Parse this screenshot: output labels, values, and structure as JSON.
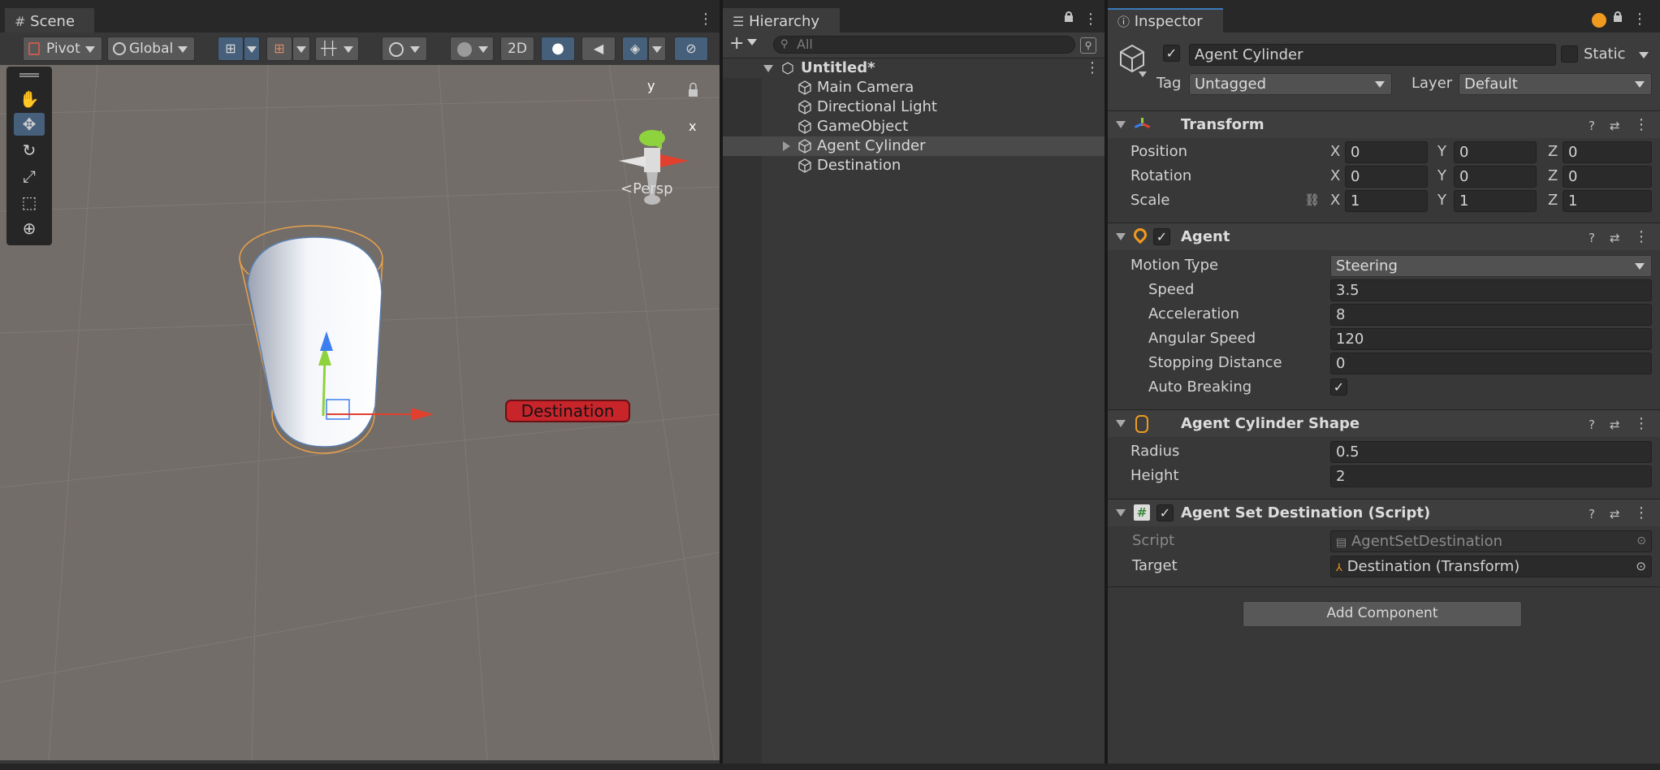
{
  "scene": {
    "tab_label": "Scene",
    "pivot_label": "Pivot",
    "global_label": "Global",
    "btn_2d": "2D",
    "persp_label": "Persp",
    "gizmo_y": "y",
    "gizmo_x": "x",
    "destination_label": "Destination",
    "tools": [
      "hand-tool-icon",
      "move-tool-icon",
      "rotate-tool-icon",
      "scale-tool-icon",
      "rect-tool-icon",
      "transform-tool-icon"
    ]
  },
  "hierarchy": {
    "tab_label": "Hierarchy",
    "search_placeholder": "All",
    "root": "Untitled*",
    "items": [
      "Main Camera",
      "Directional Light",
      "GameObject",
      "Agent Cylinder",
      "Destination"
    ]
  },
  "inspector": {
    "tab_label": "Inspector",
    "object_name": "Agent Cylinder",
    "static_label": "Static",
    "tag_label": "Tag",
    "tag_value": "Untagged",
    "layer_label": "Layer",
    "layer_value": "Default",
    "transform": {
      "title": "Transform",
      "position_label": "Position",
      "rotation_label": "Rotation",
      "scale_label": "Scale",
      "axis_x": "X",
      "axis_y": "Y",
      "axis_z": "Z",
      "position": [
        "0",
        "0",
        "0"
      ],
      "rotation": [
        "0",
        "0",
        "0"
      ],
      "scale": [
        "1",
        "1",
        "1"
      ]
    },
    "agent": {
      "title": "Agent",
      "motion_type_label": "Motion Type",
      "motion_type_value": "Steering",
      "speed_label": "Speed",
      "speed": "3.5",
      "acceleration_label": "Acceleration",
      "acceleration": "8",
      "angular_speed_label": "Angular Speed",
      "angular_speed": "120",
      "stopping_distance_label": "Stopping Distance",
      "stopping_distance": "0",
      "auto_breaking_label": "Auto Breaking",
      "auto_breaking_checked": "✓"
    },
    "shape": {
      "title": "Agent Cylinder Shape",
      "radius_label": "Radius",
      "radius": "0.5",
      "height_label": "Height",
      "height": "2"
    },
    "set_destination": {
      "title": "Agent Set Destination (Script)",
      "script_label": "Script",
      "script_value": "AgentSetDestination",
      "target_label": "Target",
      "target_value": "Destination (Transform)"
    },
    "add_component": "Add Component"
  },
  "colors": {
    "accent_blue": "#46607c",
    "scene_bg": "#736d69",
    "destination_red": "#c8252b",
    "gizmo_green": "#8ed23e",
    "gizmo_red": "#e2402f"
  }
}
